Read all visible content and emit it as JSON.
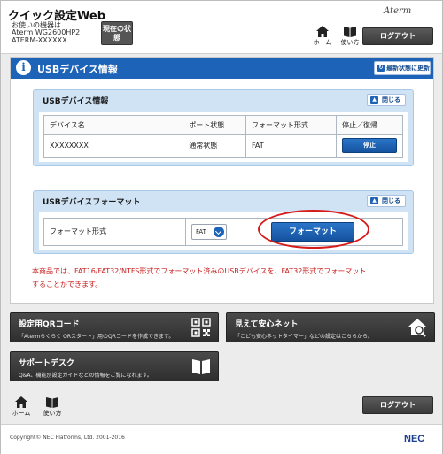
{
  "header": {
    "app_title": "クイック設定Web",
    "device_label": "お使いの機器は",
    "device_model": "Aterm WG2600HP2",
    "device_serial": "ATERM-XXXXXX",
    "status_button": "現在の状態",
    "brand": "Aterm",
    "home_label": "ホーム",
    "help_label": "使い方",
    "logout_label": "ログアウト"
  },
  "main": {
    "title": "USBデバイス情報",
    "refresh_label": "最新状態に更新",
    "device_section": {
      "title": "USBデバイス情報",
      "close_label": "閉じる",
      "columns": [
        "デバイス名",
        "ポート状態",
        "フォーマット形式",
        "停止／復帰"
      ],
      "rows": [
        {
          "name": "XXXXXXXX",
          "port_state": "通常状態",
          "format": "FAT",
          "action": "停止"
        }
      ]
    },
    "format_section": {
      "title": "USBデバイスフォーマット",
      "close_label": "閉じる",
      "field_label": "フォーマット形式",
      "selected_value": "FAT",
      "format_button": "フォーマット"
    },
    "note_line1": "本商品では、FAT16/FAT32/NTFS形式でフォーマット済みのUSBデバイスを、FAT32形式でフォーマット",
    "note_line2": "することができます。"
  },
  "tiles": [
    {
      "title": "設定用QRコード",
      "desc": "「Atermらくらく QRスタート」用のQRコードを作成できます。",
      "icon": "qr-code-icon"
    },
    {
      "title": "見えて安心ネット",
      "desc": "「こども安心ネットタイマー」などの設定はこちらから。",
      "icon": "house-search-icon"
    },
    {
      "title": "サポートデスク",
      "desc": "Q&A、機能別設定ガイドなどの情報をご覧になれます。",
      "icon": "book-icon"
    }
  ],
  "footer": {
    "home_label": "ホーム",
    "help_label": "使い方",
    "logout_label": "ログアウト",
    "copyright": "Copyright© NEC Platforms, Ltd. 2001-2016",
    "nec_logo": "NEC"
  },
  "colors": {
    "accent": "#1d63b8",
    "highlight": "#d71a1a",
    "note": "#c81e1e"
  }
}
